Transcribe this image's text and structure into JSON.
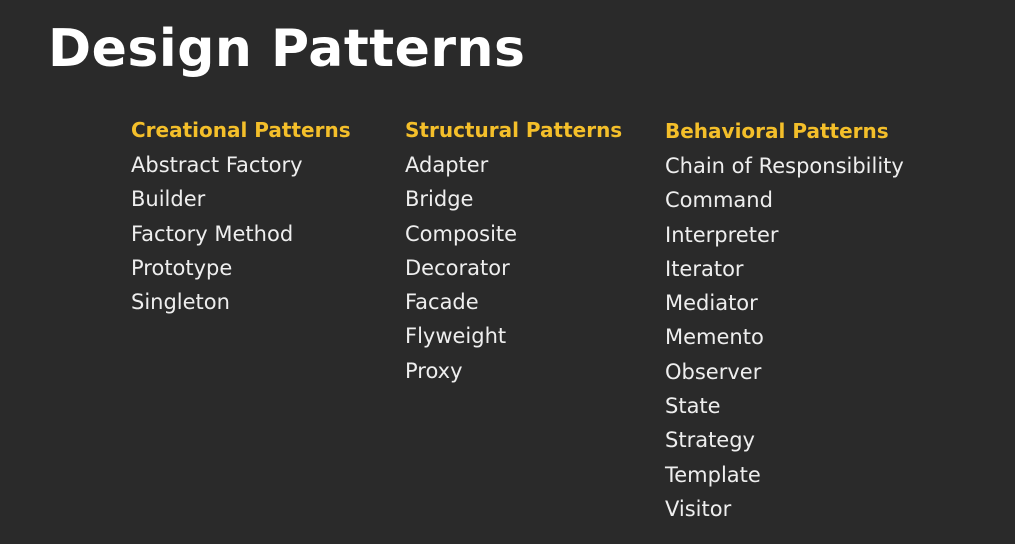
{
  "slide": {
    "title": "Design Patterns",
    "colors": {
      "background": "#2a2a2a",
      "title": "#ffffff",
      "heading": "#f4bf2a",
      "item": "#eeeeee"
    },
    "columns": [
      {
        "heading": "Creational Patterns",
        "items": [
          "Abstract Factory",
          "Builder",
          "Factory Method",
          "Prototype",
          "Singleton"
        ]
      },
      {
        "heading": "Structural Patterns",
        "items": [
          "Adapter",
          "Bridge",
          "Composite",
          "Decorator",
          "Facade",
          "Flyweight",
          "Proxy"
        ]
      },
      {
        "heading": "Behavioral Patterns",
        "items": [
          "Chain of Responsibility",
          "Command",
          "Interpreter",
          "Iterator",
          "Mediator",
          "Memento",
          "Observer",
          "State",
          "Strategy",
          "Template",
          "Visitor"
        ]
      }
    ]
  }
}
